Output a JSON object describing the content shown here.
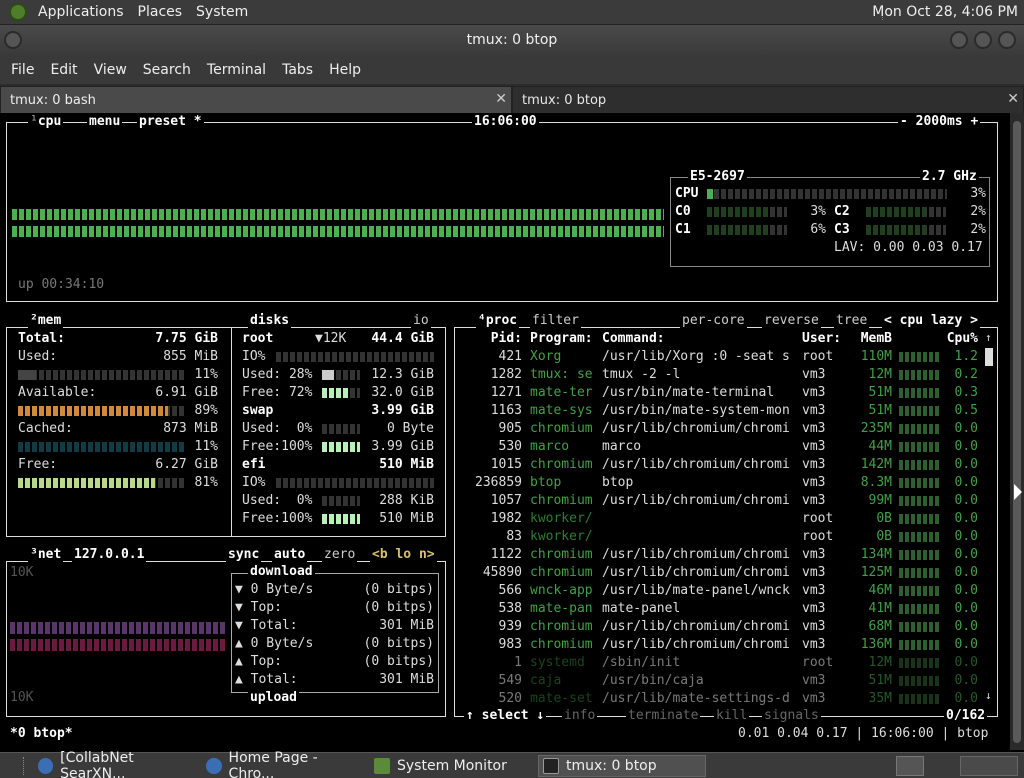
{
  "panel": {
    "menus": [
      "Applications",
      "Places",
      "System"
    ],
    "clock": "Mon Oct 28,  4:06 PM"
  },
  "window": {
    "title": "tmux: 0 btop",
    "menus": [
      "File",
      "Edit",
      "View",
      "Search",
      "Terminal",
      "Tabs",
      "Help"
    ],
    "tabs": [
      {
        "label": "tmux: 0 bash",
        "close": "✕"
      },
      {
        "label": "tmux: 0 btop",
        "close": "✕"
      }
    ]
  },
  "cpu": {
    "title_num": "¹",
    "title": "cpu",
    "menu": "menu",
    "preset": "preset *",
    "time": "16:06:00",
    "interval": "- 2000ms +",
    "uptime": "up 00:34:10",
    "model": "E5-2697",
    "freq": "2.7 GHz",
    "total_label": "CPU",
    "total_pct": "3%",
    "cores": [
      {
        "name": "C0",
        "pct": "3%"
      },
      {
        "name": "C2",
        "pct": "2%"
      },
      {
        "name": "C1",
        "pct": "6%"
      },
      {
        "name": "C3",
        "pct": "2%"
      }
    ],
    "lav": "LAV: 0.00 0.03 0.17"
  },
  "mem": {
    "title": "²mem",
    "total_label": "Total:",
    "total": "7.75 GiB",
    "used_label": "Used:",
    "used": "855 MiB",
    "used_pct": "11%",
    "avail_label": "Available:",
    "avail": "6.91 GiB",
    "avail_pct": "89%",
    "cached_label": "Cached:",
    "cached": "873 MiB",
    "cached_pct": "11%",
    "free_label": "Free:",
    "free": "6.27 GiB",
    "free_pct": "81%"
  },
  "disks": {
    "title": "disks",
    "io": "io",
    "root": {
      "name": "root",
      "io_label": "▼12K",
      "size": "44.4 GiB",
      "io": "IO%",
      "used": "Used: 28%",
      "used_v": "12.3 GiB",
      "free": "Free: 72%",
      "free_v": "32.0 GiB"
    },
    "swap": {
      "name": "swap",
      "size": "3.99 GiB",
      "used": "Used:  0%",
      "used_v": "0 Byte",
      "free": "Free:100%",
      "free_v": "3.99 GiB"
    },
    "efi": {
      "name": "efi",
      "size": "510 MiB",
      "io": "IO%",
      "used": "Used:  0%",
      "used_v": "288 KiB",
      "free": "Free:100%",
      "free_v": "510 MiB"
    }
  },
  "net": {
    "title": "³net",
    "iface": "127.0.0.1",
    "sync": "sync",
    "auto": "auto",
    "zero": "zero",
    "nav": "<b lo n>",
    "scale_top": "10K",
    "scale_bottom": "10K",
    "download": "download",
    "upload": "upload",
    "down_rate": "▼ 0 Byte/s",
    "down_rate_b": "(0 bitps)",
    "down_top": "▼ Top:",
    "down_top_b": "(0 bitps)",
    "down_total": "▼ Total:",
    "down_total_v": "301 MiB",
    "up_rate": "▲ 0 Byte/s",
    "up_rate_b": "(0 bitps)",
    "up_top": "▲ Top:",
    "up_top_b": "(0 bitps)",
    "up_total": "▲ Total:",
    "up_total_v": "301 MiB"
  },
  "proc": {
    "title": "⁴proc",
    "filter": "filter",
    "percore": "per-core",
    "reverse": "reverse",
    "tree": "tree",
    "sort": "< cpu lazy >",
    "headers": {
      "pid": "Pid:",
      "prog": "Program:",
      "cmd": "Command:",
      "user": "User:",
      "mem": "MemB",
      "cpu": "Cpu%"
    },
    "rows": [
      {
        "pid": "421",
        "prog": "Xorg",
        "cmd": "/usr/lib/Xorg :0 -seat s",
        "user": "root",
        "mem": "110M",
        "cpu": "1.2"
      },
      {
        "pid": "1282",
        "prog": "tmux: se",
        "cmd": "tmux -2 -l",
        "user": "vm3",
        "mem": "12M",
        "cpu": "0.2"
      },
      {
        "pid": "1271",
        "prog": "mate-ter",
        "cmd": "/usr/bin/mate-terminal",
        "user": "vm3",
        "mem": "51M",
        "cpu": "0.3"
      },
      {
        "pid": "1163",
        "prog": "mate-sys",
        "cmd": "/usr/bin/mate-system-mon",
        "user": "vm3",
        "mem": "51M",
        "cpu": "0.5"
      },
      {
        "pid": "905",
        "prog": "chromium",
        "cmd": "/usr/lib/chromium/chromi",
        "user": "vm3",
        "mem": "235M",
        "cpu": "0.0"
      },
      {
        "pid": "530",
        "prog": "marco",
        "cmd": "marco",
        "user": "vm3",
        "mem": "44M",
        "cpu": "0.0"
      },
      {
        "pid": "1015",
        "prog": "chromium",
        "cmd": "/usr/lib/chromium/chromi",
        "user": "vm3",
        "mem": "142M",
        "cpu": "0.0"
      },
      {
        "pid": "236859",
        "prog": "btop",
        "cmd": "btop",
        "user": "vm3",
        "mem": "8.3M",
        "cpu": "0.0"
      },
      {
        "pid": "1057",
        "prog": "chromium",
        "cmd": "/usr/lib/chromium/chromi",
        "user": "vm3",
        "mem": "99M",
        "cpu": "0.0"
      },
      {
        "pid": "1982",
        "prog": "kworker/",
        "cmd": "",
        "user": "root",
        "mem": "0B",
        "cpu": "0.0"
      },
      {
        "pid": "83",
        "prog": "kworker/",
        "cmd": "",
        "user": "root",
        "mem": "0B",
        "cpu": "0.0"
      },
      {
        "pid": "1122",
        "prog": "chromium",
        "cmd": "/usr/lib/chromium/chromi",
        "user": "vm3",
        "mem": "134M",
        "cpu": "0.0"
      },
      {
        "pid": "45890",
        "prog": "chromium",
        "cmd": "/usr/lib/chromium/chromi",
        "user": "vm3",
        "mem": "125M",
        "cpu": "0.0"
      },
      {
        "pid": "566",
        "prog": "wnck-app",
        "cmd": "/usr/lib/mate-panel/wnck",
        "user": "vm3",
        "mem": "46M",
        "cpu": "0.0"
      },
      {
        "pid": "538",
        "prog": "mate-pan",
        "cmd": "mate-panel",
        "user": "vm3",
        "mem": "41M",
        "cpu": "0.0"
      },
      {
        "pid": "939",
        "prog": "chromium",
        "cmd": "/usr/lib/chromium/chromi",
        "user": "vm3",
        "mem": "68M",
        "cpu": "0.0"
      },
      {
        "pid": "983",
        "prog": "chromium",
        "cmd": "/usr/lib/chromium/chromi",
        "user": "vm3",
        "mem": "136M",
        "cpu": "0.0"
      },
      {
        "pid": "1",
        "prog": "systemd",
        "cmd": "/sbin/init",
        "user": "root",
        "mem": "12M",
        "cpu": "0.0"
      },
      {
        "pid": "549",
        "prog": "caja",
        "cmd": "/usr/bin/caja",
        "user": "vm3",
        "mem": "51M",
        "cpu": "0.0"
      },
      {
        "pid": "520",
        "prog": "mate-set",
        "cmd": "/usr/lib/mate-settings-d",
        "user": "vm3",
        "mem": "35M",
        "cpu": "0.0"
      }
    ],
    "footer_select": "↑ select ↓",
    "footer_info": "info",
    "footer_terminate": "terminate",
    "footer_kill": "kill",
    "footer_signals": "signals",
    "count": "0/162"
  },
  "status": {
    "session": "*0 btop*",
    "right": "0.01 0.04 0.17 | 16:06:00 | btop"
  },
  "taskbar": {
    "items": [
      "[CollabNet SearXN...",
      "Home Page - Chro...",
      "System Monitor",
      "tmux: 0 btop"
    ]
  },
  "colors": {
    "green": "#4caf50",
    "prog_green": "#43a047",
    "amber": "#d08a3a",
    "teal": "#1f6e7a",
    "lime": "#b8d88a",
    "net_down": "#6a3a7a",
    "net_up": "#7a1e4a"
  }
}
